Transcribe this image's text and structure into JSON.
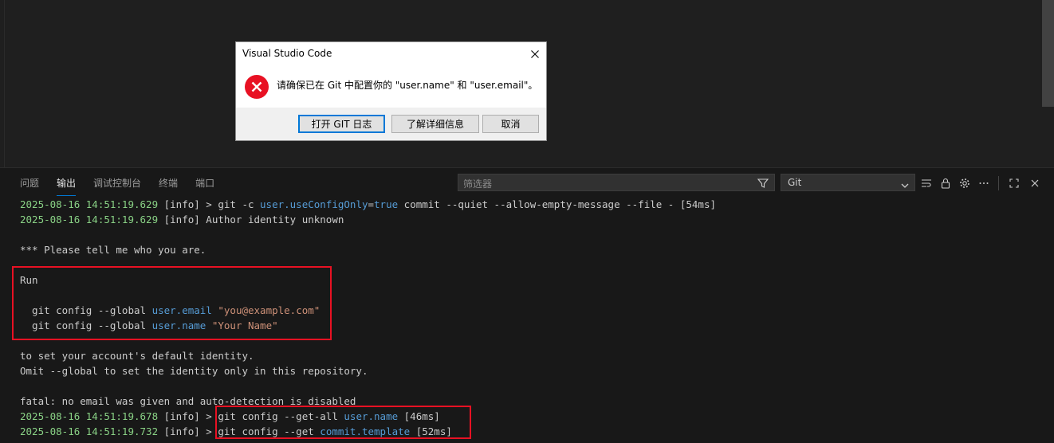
{
  "dialog": {
    "title": "Visual Studio Code",
    "message": "请确保已在 Git 中配置你的 \"user.name\" 和 \"user.email\"。",
    "buttons": {
      "open_log": "打开 GIT 日志",
      "learn_more": "了解详细信息",
      "cancel": "取消"
    }
  },
  "panel": {
    "tabs": [
      "问题",
      "输出",
      "调试控制台",
      "终端",
      "端口"
    ],
    "active_tab": "输出",
    "filter_placeholder": "筛选器",
    "channel": "Git"
  },
  "output_lines": [
    [
      {
        "t": "2025-08-16 14:51:19.629",
        "c": "ts"
      },
      {
        "t": " [info] > git -c "
      },
      {
        "t": "user.useConfigOnly",
        "c": "kw"
      },
      {
        "t": "="
      },
      {
        "t": "true",
        "c": "kw"
      },
      {
        "t": " commit --quiet --allow-empty-message --file - [54ms]"
      }
    ],
    [
      {
        "t": "2025-08-16 14:51:19.629",
        "c": "ts"
      },
      {
        "t": " [info] Author identity unknown"
      }
    ],
    [],
    [
      {
        "t": "*** Please tell me who you are."
      }
    ],
    [],
    [
      {
        "t": "Run"
      }
    ],
    [],
    [
      {
        "t": "  git config --global "
      },
      {
        "t": "user.email",
        "c": "kw"
      },
      {
        "t": " "
      },
      {
        "t": "\"you@example.com\"",
        "c": "str"
      }
    ],
    [
      {
        "t": "  git config --global "
      },
      {
        "t": "user.name",
        "c": "kw"
      },
      {
        "t": " "
      },
      {
        "t": "\"Your Name\"",
        "c": "str"
      }
    ],
    [],
    [
      {
        "t": "to set your account's default identity."
      }
    ],
    [
      {
        "t": "Omit --global to set the identity only in this repository."
      }
    ],
    [],
    [
      {
        "t": "fatal: no email was given and auto-detection is disabled"
      }
    ],
    [
      {
        "t": "2025-08-16 14:51:19.678",
        "c": "ts"
      },
      {
        "t": " [info] > git config --get-all "
      },
      {
        "t": "user.name",
        "c": "kw"
      },
      {
        "t": " [46ms]"
      }
    ],
    [
      {
        "t": "2025-08-16 14:51:19.732",
        "c": "ts"
      },
      {
        "t": " [info] > git config --get "
      },
      {
        "t": "commit.template",
        "c": "kw"
      },
      {
        "t": " [52ms]"
      }
    ]
  ]
}
